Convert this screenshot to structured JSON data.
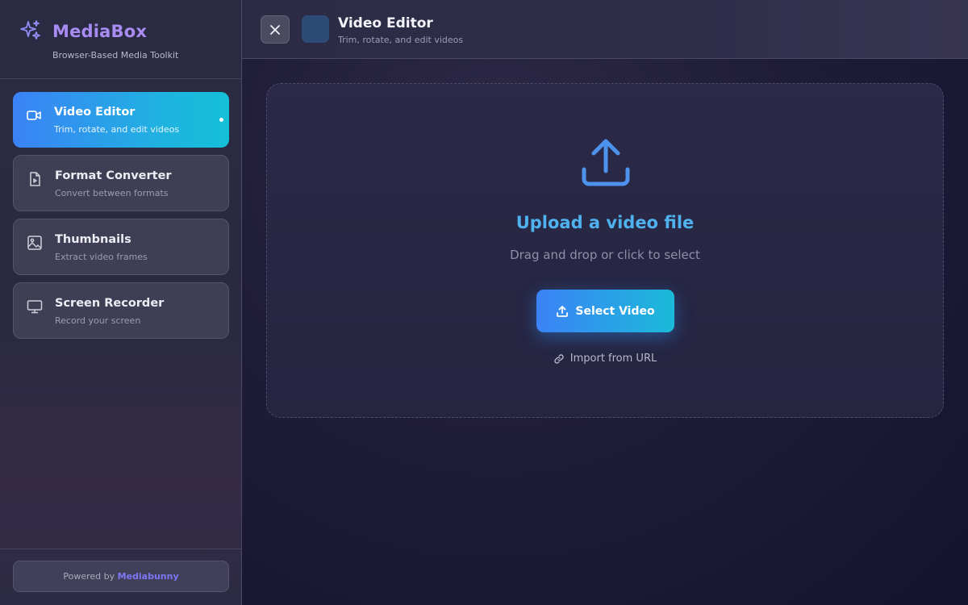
{
  "brand": {
    "name": "MediaBox",
    "subtitle": "Browser-Based Media Toolkit"
  },
  "nav": {
    "items": [
      {
        "title": "Video Editor",
        "desc": "Trim, rotate, and edit videos",
        "icon": "video-camera-icon",
        "active": true
      },
      {
        "title": "Format Converter",
        "desc": "Convert between formats",
        "icon": "file-play-icon",
        "active": false
      },
      {
        "title": "Thumbnails",
        "desc": "Extract video frames",
        "icon": "image-icon",
        "active": false
      },
      {
        "title": "Screen Recorder",
        "desc": "Record your screen",
        "icon": "monitor-icon",
        "active": false
      }
    ]
  },
  "footer": {
    "powered_prefix": "Powered by",
    "powered_brand": "Mediabunny"
  },
  "topbar": {
    "title": "Video Editor",
    "subtitle": "Trim, rotate, and edit videos",
    "close_icon": "close-icon"
  },
  "dropzone": {
    "title": "Upload a video file",
    "subtitle": "Drag and drop or click to select",
    "select_label": "Select Video",
    "import_label": "Import from URL"
  },
  "colors": {
    "accent_blue": "#3b82f6",
    "accent_cyan": "#14c0d8",
    "brand_purple": "#a98cf2",
    "link_blue": "#4fb2ee"
  }
}
